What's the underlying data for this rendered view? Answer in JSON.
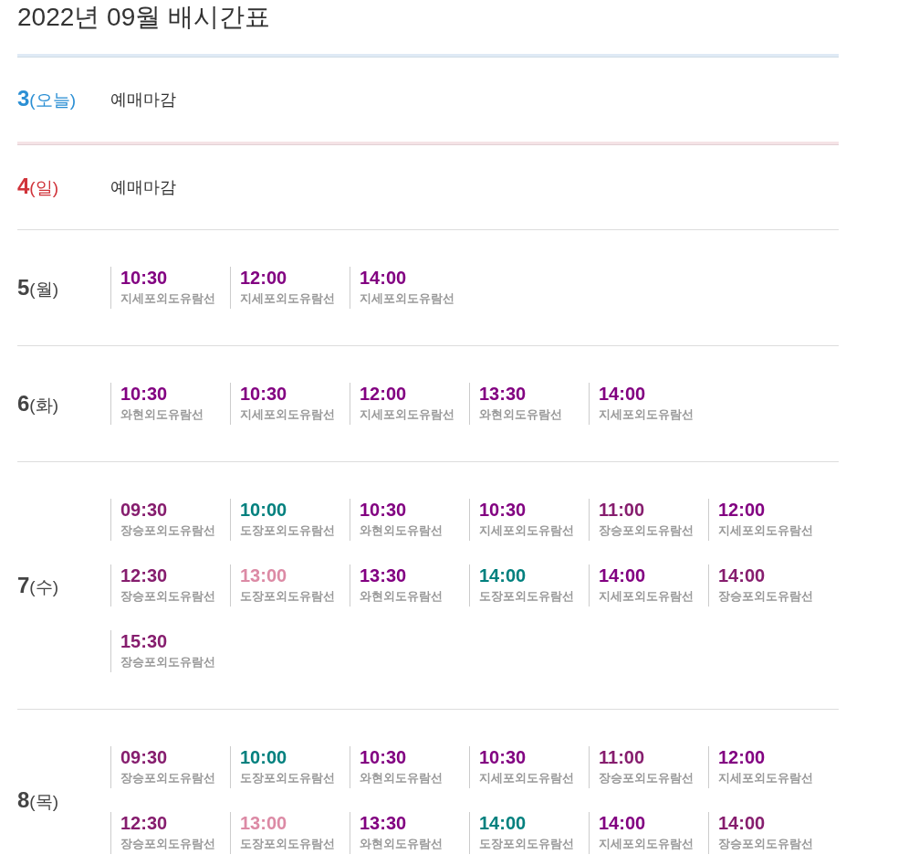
{
  "title": "2022년 09월 배시간표",
  "days": [
    {
      "kind": "today",
      "date": "3",
      "weekday": "(오늘)",
      "status": "예매마감"
    },
    {
      "kind": "holiday",
      "date": "4",
      "weekday": "(일)",
      "status": "예매마감"
    },
    {
      "kind": "normal",
      "date": "5",
      "weekday": "(월)",
      "slots": [
        {
          "time": "10:30",
          "route": "지세포외도유람선",
          "color": "#820081"
        },
        {
          "time": "12:00",
          "route": "지세포외도유람선",
          "color": "#820081"
        },
        {
          "time": "14:00",
          "route": "지세포외도유람선",
          "color": "#820081"
        }
      ]
    },
    {
      "kind": "normal",
      "date": "6",
      "weekday": "(화)",
      "slots": [
        {
          "time": "10:30",
          "route": "와현외도유람선",
          "color": "#820081"
        },
        {
          "time": "10:30",
          "route": "지세포외도유람선",
          "color": "#820081"
        },
        {
          "time": "12:00",
          "route": "지세포외도유람선",
          "color": "#820081"
        },
        {
          "time": "13:30",
          "route": "와현외도유람선",
          "color": "#820081"
        },
        {
          "time": "14:00",
          "route": "지세포외도유람선",
          "color": "#820081"
        }
      ]
    },
    {
      "kind": "normal",
      "date": "7",
      "weekday": "(수)",
      "slots": [
        {
          "time": "09:30",
          "route": "장승포외도유람선",
          "color": "#861d6e"
        },
        {
          "time": "10:00",
          "route": "도장포외도유람선",
          "color": "#00807e"
        },
        {
          "time": "10:30",
          "route": "와현외도유람선",
          "color": "#820081"
        },
        {
          "time": "10:30",
          "route": "지세포외도유람선",
          "color": "#820081"
        },
        {
          "time": "11:00",
          "route": "장승포외도유람선",
          "color": "#861d6e"
        },
        {
          "time": "12:00",
          "route": "지세포외도유람선",
          "color": "#820081"
        },
        {
          "time": "12:30",
          "route": "장승포외도유람선",
          "color": "#861d6e"
        },
        {
          "time": "13:00",
          "route": "도장포외도유람선",
          "color": "#dc8aa5"
        },
        {
          "time": "13:30",
          "route": "와현외도유람선",
          "color": "#820081"
        },
        {
          "time": "14:00",
          "route": "도장포외도유람선",
          "color": "#00807e"
        },
        {
          "time": "14:00",
          "route": "지세포외도유람선",
          "color": "#820081"
        },
        {
          "time": "14:00",
          "route": "장승포외도유람선",
          "color": "#861d6e"
        },
        {
          "time": "15:30",
          "route": "장승포외도유람선",
          "color": "#861d6e"
        }
      ]
    },
    {
      "kind": "normal",
      "date": "8",
      "weekday": "(목)",
      "slots": [
        {
          "time": "09:30",
          "route": "장승포외도유람선",
          "color": "#861d6e"
        },
        {
          "time": "10:00",
          "route": "도장포외도유람선",
          "color": "#00807e"
        },
        {
          "time": "10:30",
          "route": "와현외도유람선",
          "color": "#820081"
        },
        {
          "time": "10:30",
          "route": "지세포외도유람선",
          "color": "#820081"
        },
        {
          "time": "11:00",
          "route": "장승포외도유람선",
          "color": "#861d6e"
        },
        {
          "time": "12:00",
          "route": "지세포외도유람선",
          "color": "#820081"
        },
        {
          "time": "12:30",
          "route": "장승포외도유람선",
          "color": "#861d6e"
        },
        {
          "time": "13:00",
          "route": "도장포외도유람선",
          "color": "#dc8aa5"
        },
        {
          "time": "13:30",
          "route": "와현외도유람선",
          "color": "#820081"
        },
        {
          "time": "14:00",
          "route": "도장포외도유람선",
          "color": "#00807e"
        },
        {
          "time": "14:00",
          "route": "지세포외도유람선",
          "color": "#820081"
        },
        {
          "time": "14:00",
          "route": "장승포외도유람선",
          "color": "#861d6e"
        }
      ]
    }
  ]
}
